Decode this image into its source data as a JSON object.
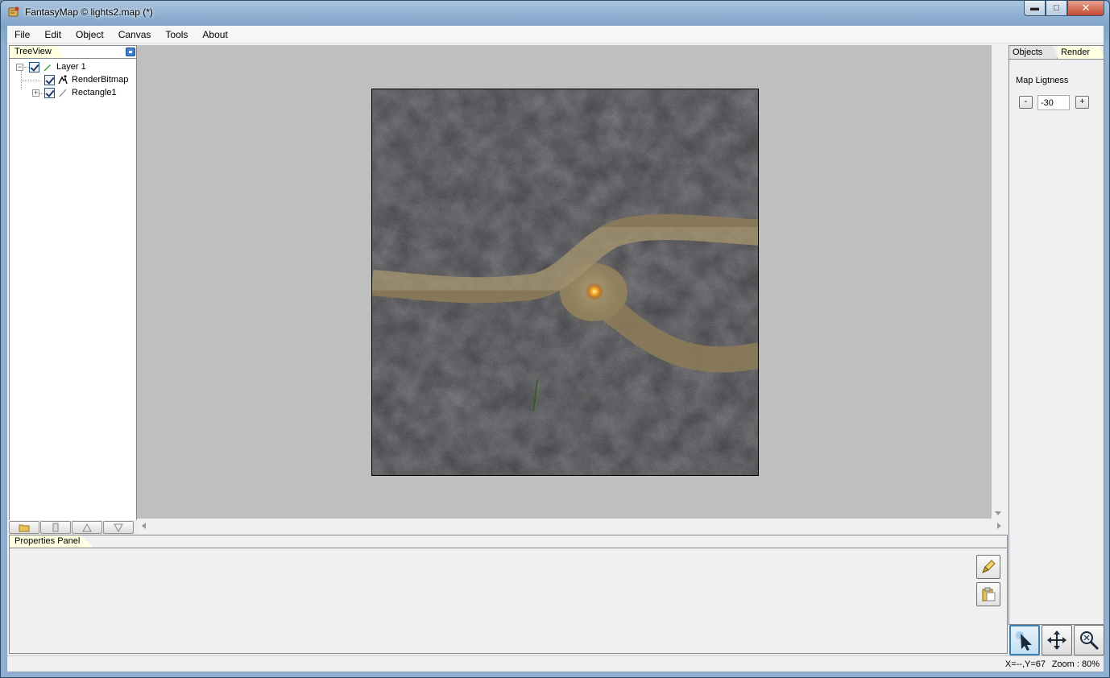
{
  "window": {
    "title": "FantasyMap © lights2.map (*)",
    "minimize": "▬",
    "maximize": "□",
    "close": "✕"
  },
  "menu": [
    "File",
    "Edit",
    "Object",
    "Canvas",
    "Tools",
    "About"
  ],
  "treeview": {
    "tab_label": "TreeView",
    "nodes": [
      {
        "label": "Layer 1",
        "expander": "−",
        "checked": true,
        "icon": "pencil-icon"
      },
      {
        "label": "RenderBitmap",
        "checked": true,
        "icon": "render-icon"
      },
      {
        "label": "Rectangle1",
        "expander": "+",
        "checked": true,
        "icon": "line-icon"
      }
    ]
  },
  "left_toolbar": [
    "open-folder-icon",
    "clipboard-icon",
    "triangle-up-icon",
    "triangle-down-icon"
  ],
  "properties_panel": {
    "tab_label": "Properties Panel",
    "buttons": [
      "brush-icon",
      "paste-icon"
    ]
  },
  "right_panel": {
    "tabs": [
      "Objects",
      "Render"
    ],
    "active_tab": "Render",
    "map_lightness_label": "Map Ligtness",
    "minus_label": "-",
    "plus_label": "+",
    "lightness_value": "-30"
  },
  "tools": [
    "select-arrow-icon",
    "move-icon",
    "zoom-icon"
  ],
  "active_tool": "select-arrow-icon",
  "status": {
    "coords": "X=--,Y=67",
    "zoom": "Zoom : 80%"
  },
  "colors": {
    "canvas_bg": "#bfbfbf",
    "tab_bg": "#ffffe1",
    "path_color": "#8a7a58",
    "rock_color": "#4a4a4e"
  }
}
